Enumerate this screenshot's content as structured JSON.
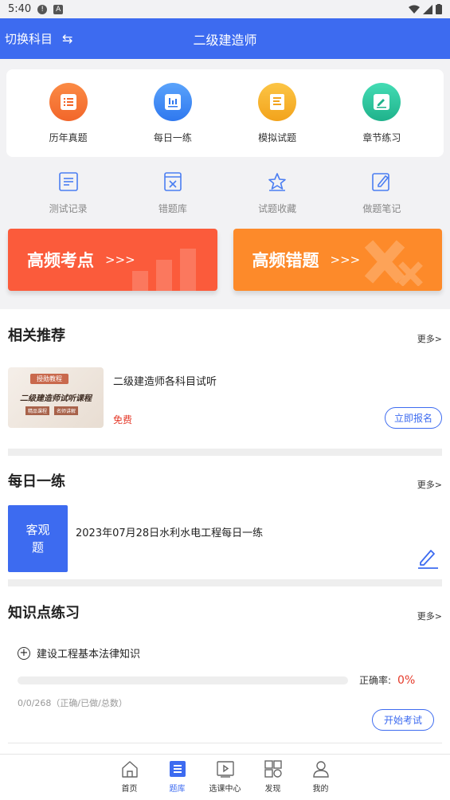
{
  "status_bar": {
    "time": "5:40"
  },
  "header": {
    "switch_label": "切换科目",
    "title": "二级建造师"
  },
  "top_grid": [
    {
      "label": "历年真题",
      "color": "#f7742f",
      "icon": "list-icon"
    },
    {
      "label": "每日一练",
      "color": "#3d8af7",
      "icon": "chart-icon"
    },
    {
      "label": "模拟试题",
      "color": "#f7b42a",
      "icon": "document-icon"
    },
    {
      "label": "章节练习",
      "color": "#2fc7a0",
      "icon": "edit-icon"
    }
  ],
  "second_row": [
    {
      "label": "测试记录",
      "icon": "record-icon"
    },
    {
      "label": "错题库",
      "icon": "wrong-book-icon"
    },
    {
      "label": "试题收藏",
      "icon": "star-icon"
    },
    {
      "label": "做题笔记",
      "icon": "note-icon"
    }
  ],
  "banners": {
    "left": {
      "text": "高频考点",
      "arrows": ">>>"
    },
    "right": {
      "text": "高频错题",
      "arrows": ">>>"
    }
  },
  "related": {
    "title": "相关推荐",
    "more": "更多>",
    "item": {
      "thumb_badge": "授勋教程",
      "thumb_title": "二级建造师试听课程",
      "thumb_tag1": "精品课程",
      "thumb_tag2": "名师讲解",
      "title": "二级建造师各科目试听",
      "price": "免费",
      "button": "立即报名"
    }
  },
  "daily": {
    "title": "每日一练",
    "more": "更多>",
    "box_label": "客观题",
    "item_title": "2023年07月28日水利水电工程每日一练"
  },
  "knowledge": {
    "title": "知识点练习",
    "more": "更多>",
    "item_name": "建设工程基本法律知识",
    "accuracy_label": "正确率:",
    "accuracy_value": "0%",
    "progress": 0,
    "stats": "0/0/268（正确/已做/总数）",
    "button": "开始考试"
  },
  "bottom_nav": [
    {
      "label": "首页",
      "icon": "home-icon",
      "active": false
    },
    {
      "label": "题库",
      "icon": "question-bank-icon",
      "active": true
    },
    {
      "label": "选课中心",
      "icon": "course-icon",
      "active": false
    },
    {
      "label": "发现",
      "icon": "discover-icon",
      "active": false
    },
    {
      "label": "我的",
      "icon": "profile-icon",
      "active": false
    }
  ]
}
